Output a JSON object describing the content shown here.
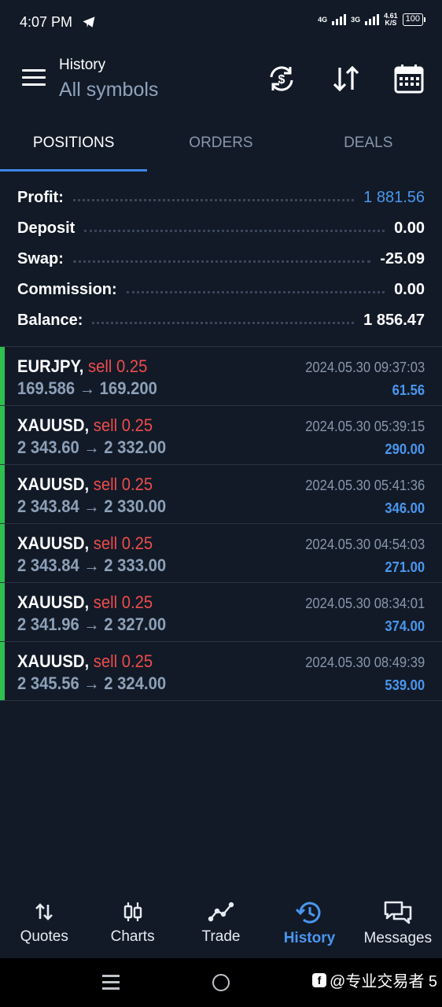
{
  "status_bar": {
    "time": "4:07 PM",
    "network1": "4G",
    "network2": "3G",
    "speed_value": "4.61",
    "speed_unit": "K/S",
    "battery": "100"
  },
  "header": {
    "title": "History",
    "subtitle": "All symbols",
    "icons": [
      "sync-currency-icon",
      "sort-icon",
      "calendar-icon"
    ]
  },
  "tabs": [
    {
      "label": "POSITIONS",
      "active": true
    },
    {
      "label": "ORDERS",
      "active": false
    },
    {
      "label": "DEALS",
      "active": false
    }
  ],
  "summary": {
    "profit_label": "Profit:",
    "profit_value": "1 881.56",
    "deposit_label": "Deposit",
    "deposit_value": "0.00",
    "swap_label": "Swap:",
    "swap_value": "-25.09",
    "commission_label": "Commission:",
    "commission_value": "0.00",
    "balance_label": "Balance:",
    "balance_value": "1 856.47"
  },
  "positions": [
    {
      "symbol": "EURJPY,",
      "side": "sell 0.25",
      "open": "169.586",
      "arrow": "→",
      "close": "169.200",
      "time": "2024.05.30 09:37:03",
      "profit": "61.56"
    },
    {
      "symbol": "XAUUSD,",
      "side": "sell 0.25",
      "open": "2 343.60",
      "arrow": "→",
      "close": "2 332.00",
      "time": "2024.05.30 05:39:15",
      "profit": "290.00"
    },
    {
      "symbol": "XAUUSD,",
      "side": "sell 0.25",
      "open": "2 343.84",
      "arrow": "→",
      "close": "2 330.00",
      "time": "2024.05.30 05:41:36",
      "profit": "346.00"
    },
    {
      "symbol": "XAUUSD,",
      "side": "sell 0.25",
      "open": "2 343.84",
      "arrow": "→",
      "close": "2 333.00",
      "time": "2024.05.30 04:54:03",
      "profit": "271.00"
    },
    {
      "symbol": "XAUUSD,",
      "side": "sell 0.25",
      "open": "2 341.96",
      "arrow": "→",
      "close": "2 327.00",
      "time": "2024.05.30 08:34:01",
      "profit": "374.00"
    },
    {
      "symbol": "XAUUSD,",
      "side": "sell 0.25",
      "open": "2 345.56",
      "arrow": "→",
      "close": "2 324.00",
      "time": "2024.05.30 08:49:39",
      "profit": "539.00"
    }
  ],
  "bottom_nav": [
    {
      "label": "Quotes",
      "icon": "quotes-icon",
      "active": false
    },
    {
      "label": "Charts",
      "icon": "charts-icon",
      "active": false
    },
    {
      "label": "Trade",
      "icon": "trade-icon",
      "active": false
    },
    {
      "label": "History",
      "icon": "history-icon",
      "active": true
    },
    {
      "label": "Messages",
      "icon": "messages-icon",
      "active": false
    }
  ],
  "watermark": "@专业交易者 5",
  "colors": {
    "background": "#121a27",
    "accent": "#4a97ef",
    "sell": "#ef4c4c",
    "position_bar": "#2fbf4f"
  }
}
